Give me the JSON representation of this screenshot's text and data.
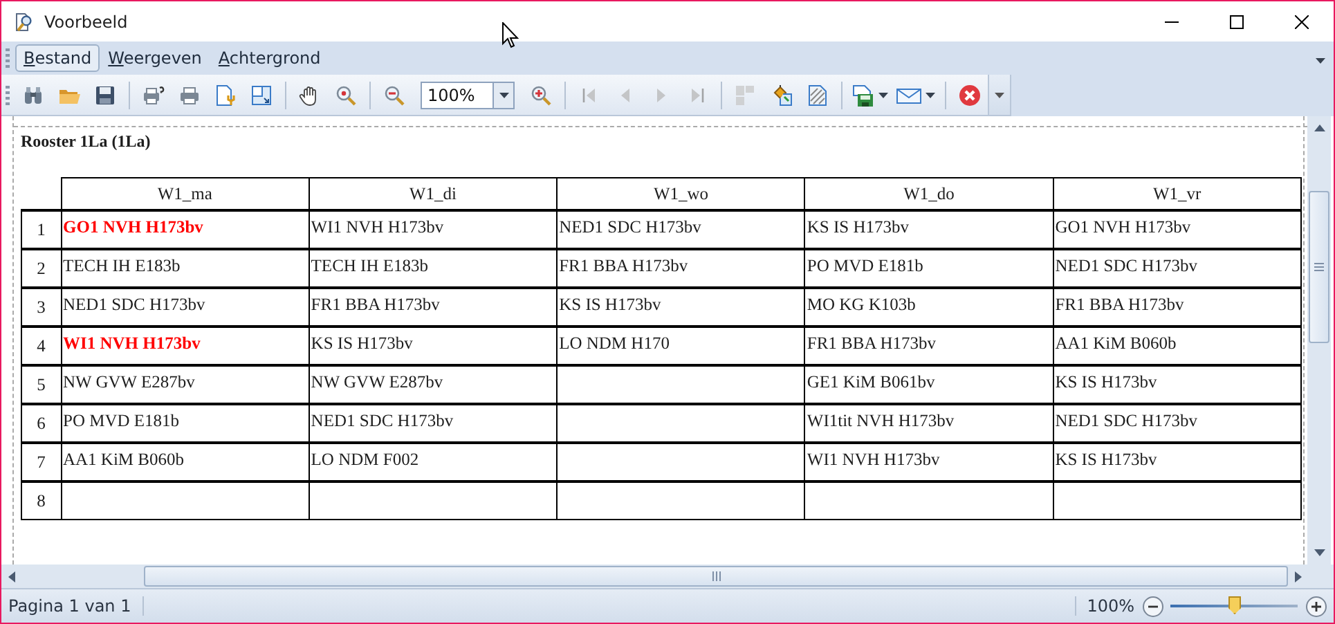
{
  "window": {
    "title": "Voorbeeld"
  },
  "menu": [
    {
      "label": "Bestand",
      "selected": true
    },
    {
      "label": "Weergeven",
      "selected": false
    },
    {
      "label": "Achtergrond",
      "selected": false
    }
  ],
  "toolbar": {
    "groups": [
      [
        {
          "kind": "find",
          "disabled": false
        },
        {
          "kind": "open",
          "disabled": false
        },
        {
          "kind": "save",
          "disabled": false
        }
      ],
      [
        {
          "kind": "print-setup",
          "disabled": false
        },
        {
          "kind": "print",
          "disabled": false
        },
        {
          "kind": "page-setup",
          "disabled": false
        },
        {
          "kind": "scale",
          "disabled": false
        }
      ],
      [
        {
          "kind": "hand",
          "disabled": false
        },
        {
          "kind": "magnifier",
          "disabled": false
        }
      ],
      [
        {
          "kind": "zoom-out",
          "disabled": false
        },
        {
          "kind": "zoom-combo",
          "value": "100%"
        },
        {
          "kind": "zoom-in",
          "disabled": false
        }
      ],
      [
        {
          "kind": "first",
          "disabled": true
        },
        {
          "kind": "prev",
          "disabled": true
        },
        {
          "kind": "next",
          "disabled": true
        },
        {
          "kind": "last",
          "disabled": true
        }
      ],
      [
        {
          "kind": "multipage",
          "disabled": true
        },
        {
          "kind": "color",
          "disabled": false
        },
        {
          "kind": "watermark",
          "disabled": false
        }
      ],
      [
        {
          "kind": "export",
          "disabled": false,
          "dropdown": true
        },
        {
          "kind": "email",
          "disabled": false,
          "dropdown": true
        }
      ],
      [
        {
          "kind": "close",
          "disabled": false
        }
      ]
    ]
  },
  "report": {
    "title": "Rooster 1La (1La)",
    "columns": [
      "W1_ma",
      "W1_di",
      "W1_wo",
      "W1_do",
      "W1_vr"
    ],
    "rows": [
      {
        "number": "1",
        "cells": [
          {
            "text": "GO1 NVH H173bv",
            "highlighted": true
          },
          {
            "text": "WI1 NVH H173bv",
            "highlighted": false
          },
          {
            "text": "NED1 SDC H173bv",
            "highlighted": false
          },
          {
            "text": "KS IS H173bv",
            "highlighted": false
          },
          {
            "text": "GO1 NVH H173bv",
            "highlighted": false
          }
        ]
      },
      {
        "number": "2",
        "cells": [
          {
            "text": "TECH IH E183b",
            "highlighted": false
          },
          {
            "text": "TECH IH E183b",
            "highlighted": false
          },
          {
            "text": "FR1 BBA H173bv",
            "highlighted": false
          },
          {
            "text": "PO MVD E181b",
            "highlighted": false
          },
          {
            "text": "NED1 SDC H173bv",
            "highlighted": false
          }
        ]
      },
      {
        "number": "3",
        "cells": [
          {
            "text": "NED1 SDC H173bv",
            "highlighted": false
          },
          {
            "text": "FR1 BBA H173bv",
            "highlighted": false
          },
          {
            "text": "KS IS H173bv",
            "highlighted": false
          },
          {
            "text": "MO KG K103b",
            "highlighted": false
          },
          {
            "text": "FR1 BBA H173bv",
            "highlighted": false
          }
        ]
      },
      {
        "number": "4",
        "cells": [
          {
            "text": "WI1 NVH H173bv",
            "highlighted": true
          },
          {
            "text": "KS IS H173bv",
            "highlighted": false
          },
          {
            "text": "LO NDM H170",
            "highlighted": false
          },
          {
            "text": "FR1 BBA H173bv",
            "highlighted": false
          },
          {
            "text": "AA1 KiM B060b",
            "highlighted": false
          }
        ]
      },
      {
        "number": "5",
        "cells": [
          {
            "text": "NW GVW E287bv",
            "highlighted": false
          },
          {
            "text": "NW GVW E287bv",
            "highlighted": false
          },
          {},
          {
            "text": "GE1 KiM B061bv",
            "highlighted": false
          },
          {
            "text": "KS IS H173bv",
            "highlighted": false
          }
        ]
      },
      {
        "number": "6",
        "cells": [
          {
            "text": "PO MVD E181b",
            "highlighted": false
          },
          {
            "text": "NED1 SDC H173bv",
            "highlighted": false
          },
          {},
          {
            "text": "WI1tit NVH H173bv",
            "highlighted": false
          },
          {
            "text": "NED1 SDC H173bv",
            "highlighted": false
          }
        ]
      },
      {
        "number": "7",
        "cells": [
          {
            "text": "AA1 KiM B060b",
            "highlighted": false
          },
          {
            "text": "LO NDM F002",
            "highlighted": false
          },
          {},
          {
            "text": "WI1 NVH H173bv",
            "highlighted": false
          },
          {
            "text": "KS IS H173bv",
            "highlighted": false
          }
        ]
      },
      {
        "number": "8",
        "cells": [
          {},
          {},
          {},
          {},
          {}
        ]
      }
    ]
  },
  "status_bar": {
    "page": "Pagina 1 van 1",
    "zoom": "100%",
    "zoom_slider": {
      "level": 0.5
    }
  }
}
